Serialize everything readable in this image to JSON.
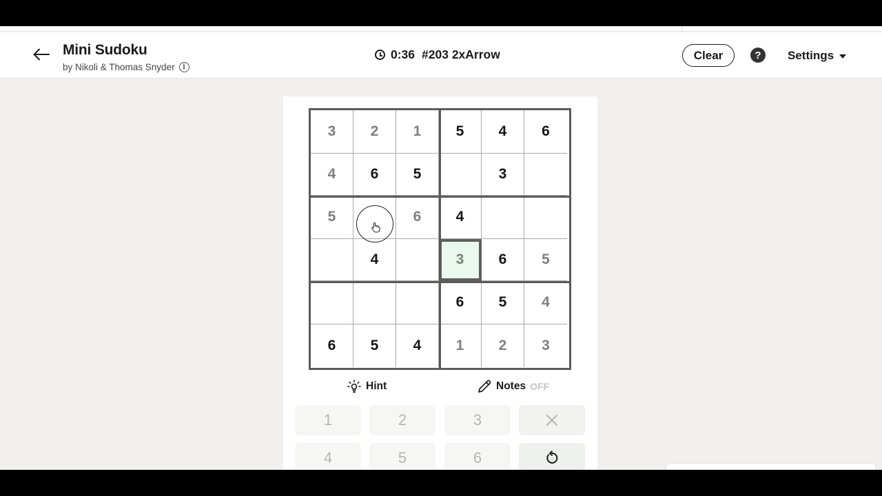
{
  "header": {
    "title": "Mini Sudoku",
    "byline": "by Nikoli & Thomas Snyder",
    "timer": "0:36",
    "puzzle_id": "#203 2xArrow",
    "clear_label": "Clear",
    "help_label": "?",
    "settings_label": "Settings"
  },
  "grid": {
    "rows": [
      [
        {
          "v": "3",
          "t": "filled"
        },
        {
          "v": "2",
          "t": "filled"
        },
        {
          "v": "1",
          "t": "filled"
        },
        {
          "v": "5",
          "t": "given"
        },
        {
          "v": "4",
          "t": "given"
        },
        {
          "v": "6",
          "t": "given"
        }
      ],
      [
        {
          "v": "4",
          "t": "filled"
        },
        {
          "v": "6",
          "t": "given"
        },
        {
          "v": "5",
          "t": "given"
        },
        {
          "v": "",
          "t": "empty"
        },
        {
          "v": "3",
          "t": "given"
        },
        {
          "v": "",
          "t": "empty"
        }
      ],
      [
        {
          "v": "5",
          "t": "filled"
        },
        {
          "v": "",
          "t": "empty"
        },
        {
          "v": "6",
          "t": "filled"
        },
        {
          "v": "4",
          "t": "given"
        },
        {
          "v": "",
          "t": "empty"
        },
        {
          "v": "",
          "t": "empty"
        }
      ],
      [
        {
          "v": "",
          "t": "empty"
        },
        {
          "v": "4",
          "t": "given"
        },
        {
          "v": "",
          "t": "empty"
        },
        {
          "v": "3",
          "t": "filled",
          "selected": true
        },
        {
          "v": "6",
          "t": "given"
        },
        {
          "v": "5",
          "t": "filled"
        }
      ],
      [
        {
          "v": "",
          "t": "empty"
        },
        {
          "v": "",
          "t": "empty"
        },
        {
          "v": "",
          "t": "empty"
        },
        {
          "v": "6",
          "t": "given"
        },
        {
          "v": "5",
          "t": "given"
        },
        {
          "v": "4",
          "t": "filled"
        }
      ],
      [
        {
          "v": "6",
          "t": "given"
        },
        {
          "v": "5",
          "t": "given"
        },
        {
          "v": "4",
          "t": "given"
        },
        {
          "v": "1",
          "t": "filled"
        },
        {
          "v": "2",
          "t": "filled"
        },
        {
          "v": "3",
          "t": "filled"
        }
      ]
    ]
  },
  "tools": {
    "hint_label": "Hint",
    "notes_label": "Notes",
    "notes_state": "OFF"
  },
  "keypad": {
    "keys": [
      "1",
      "2",
      "3",
      "4",
      "5",
      "6"
    ],
    "erase_icon": "close-icon",
    "undo_icon": "undo-icon"
  },
  "colors": {
    "given_digit": "#151515",
    "filled_digit": "#7f7f7f",
    "selected_cell": "#eaf8ee",
    "background": "#f1f0ec"
  }
}
